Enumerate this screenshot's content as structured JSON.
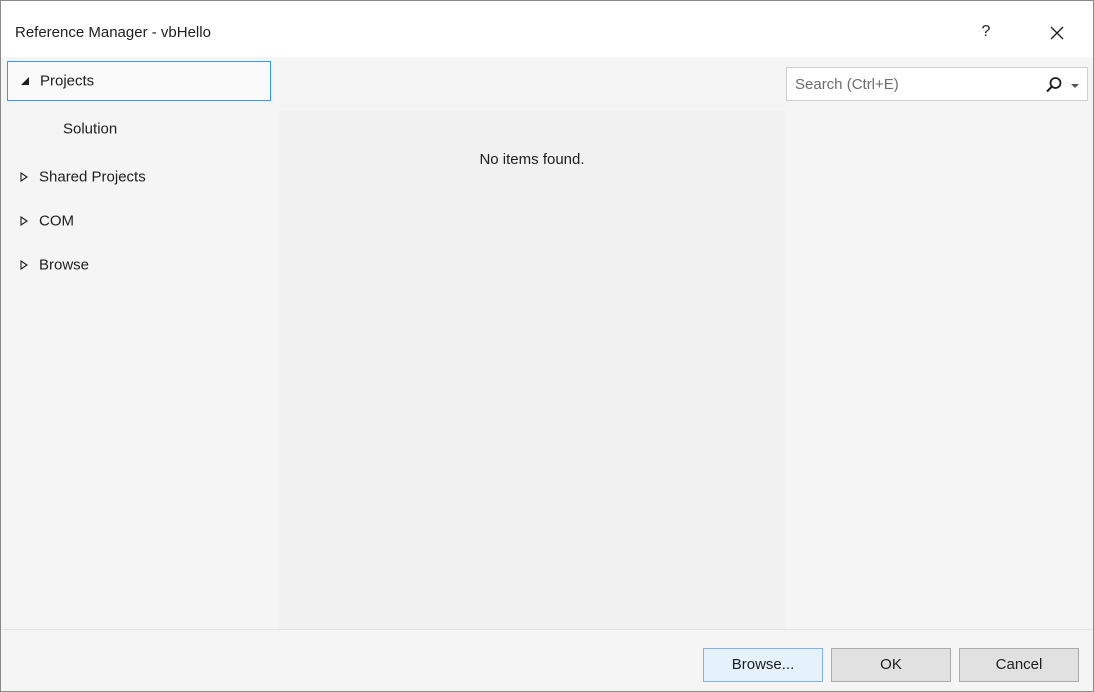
{
  "window": {
    "title": "Reference Manager - vbHello",
    "help_label": "?"
  },
  "nav": {
    "items": [
      {
        "label": "Projects",
        "state": "expanded",
        "selected": true
      },
      {
        "label": "Solution",
        "state": "child",
        "selected": false
      },
      {
        "label": "Shared Projects",
        "state": "collapsed",
        "selected": false
      },
      {
        "label": "COM",
        "state": "collapsed",
        "selected": false
      },
      {
        "label": "Browse",
        "state": "collapsed",
        "selected": false
      }
    ]
  },
  "search": {
    "placeholder": "Search (Ctrl+E)",
    "value": ""
  },
  "content": {
    "empty_message": "No items found."
  },
  "buttons": {
    "browse": "Browse...",
    "ok": "OK",
    "cancel": "Cancel"
  },
  "icons": {
    "close": "close-icon",
    "search": "search-icon",
    "dropdown": "chevron-down-icon",
    "expanded": "triangle-down-right-icon",
    "collapsed": "triangle-right-outline-icon"
  },
  "colors": {
    "selection_border": "#3399ff",
    "window_background": "#f5f5f5",
    "content_background": "#f1f1f1",
    "focused_button": "#e5f1fb"
  }
}
